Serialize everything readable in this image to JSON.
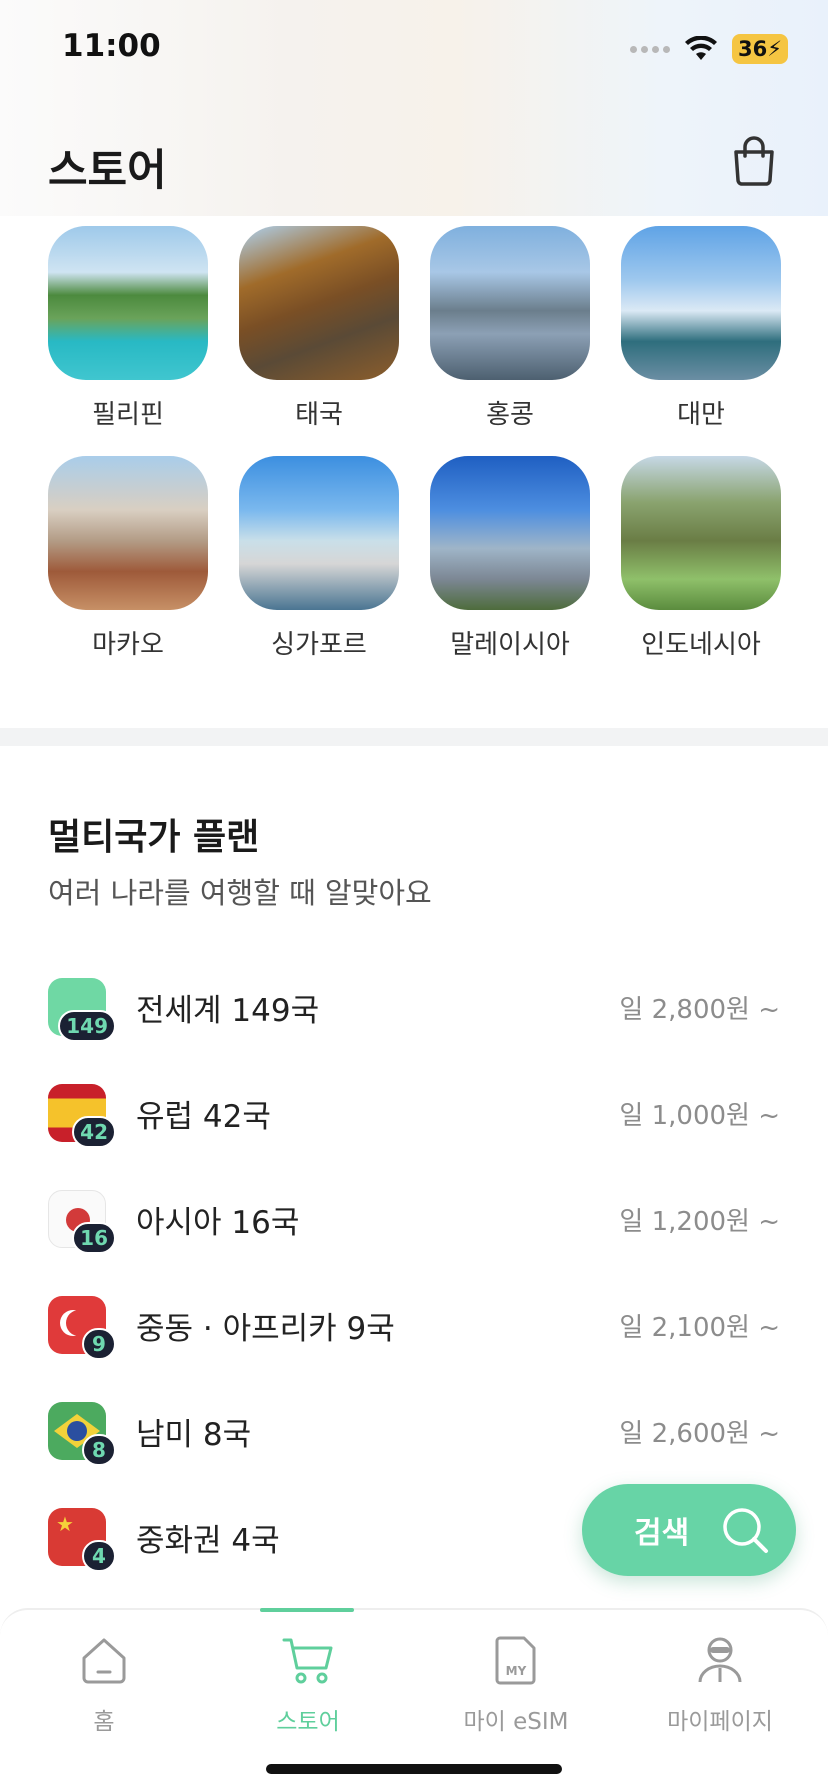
{
  "status_bar": {
    "time": "11:00",
    "battery": "36"
  },
  "header": {
    "title": "스토어"
  },
  "countries": [
    {
      "name": "필리핀"
    },
    {
      "name": "태국"
    },
    {
      "name": "홍콩"
    },
    {
      "name": "대만"
    },
    {
      "name": "마카오"
    },
    {
      "name": "싱가포르"
    },
    {
      "name": "말레이시아"
    },
    {
      "name": "인도네시아"
    }
  ],
  "multi": {
    "title": "멀티국가 플랜",
    "subtitle": "여러 나라를 여행할 때 알맞아요",
    "plans": [
      {
        "name": "전세계 149국",
        "badge": "149",
        "price": "일 2,800원 ~"
      },
      {
        "name": "유럽 42국",
        "badge": "42",
        "price": "일 1,000원 ~"
      },
      {
        "name": "아시아 16국",
        "badge": "16",
        "price": "일 1,200원 ~"
      },
      {
        "name": "중동 · 아프리카 9국",
        "badge": "9",
        "price": "일 2,100원 ~"
      },
      {
        "name": "남미 8국",
        "badge": "8",
        "price": "일 2,600원 ~"
      },
      {
        "name": "중화권 4국",
        "badge": "4",
        "price": ""
      }
    ]
  },
  "search_fab": {
    "label": "검색"
  },
  "nav": [
    {
      "label": "홈",
      "icon": "home-icon"
    },
    {
      "label": "스토어",
      "icon": "cart-icon"
    },
    {
      "label": "마이 eSIM",
      "icon": "sim-card-icon"
    },
    {
      "label": "마이페이지",
      "icon": "profile-icon"
    }
  ],
  "colors": {
    "accent": "#5fcf9c",
    "fab": "#67d4a6",
    "badge_bg": "#1b2133"
  }
}
